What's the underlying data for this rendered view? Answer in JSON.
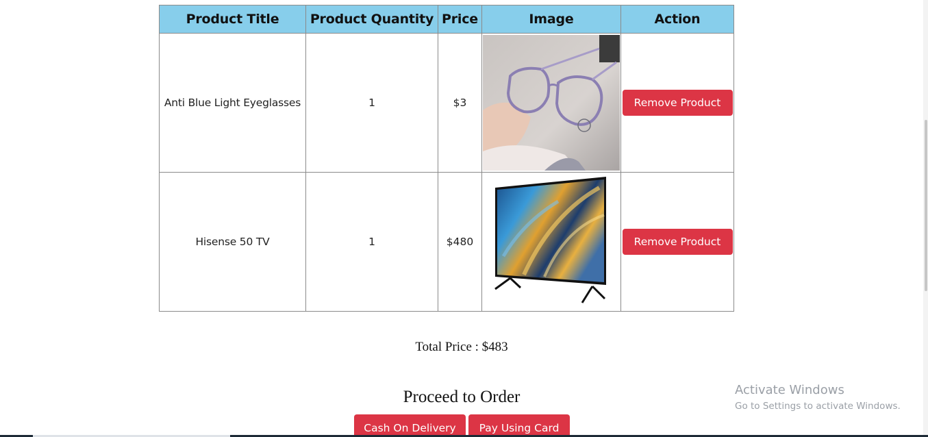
{
  "table": {
    "headers": {
      "title": "Product Title",
      "quantity": "Product Quantity",
      "price": "Price",
      "image": "Image",
      "action": "Action"
    },
    "rows": [
      {
        "title": "Anti Blue Light Eyeglasses",
        "quantity": "1",
        "price": "$3",
        "image_icon": "eyeglasses-image",
        "action_label": "Remove Product"
      },
      {
        "title": "Hisense 50 TV",
        "quantity": "1",
        "price": "$480",
        "image_icon": "television-image",
        "action_label": "Remove Product"
      }
    ]
  },
  "summary": {
    "total": "Total Price : $483"
  },
  "checkout": {
    "heading": "Proceed to Order",
    "cash_label": "Cash On Delivery",
    "card_label": "Pay Using Card"
  },
  "watermark": {
    "title": "Activate Windows",
    "subtitle": "Go to Settings to activate Windows."
  },
  "colors": {
    "header_bg": "#87ceeb",
    "button_red": "#dc3545"
  }
}
